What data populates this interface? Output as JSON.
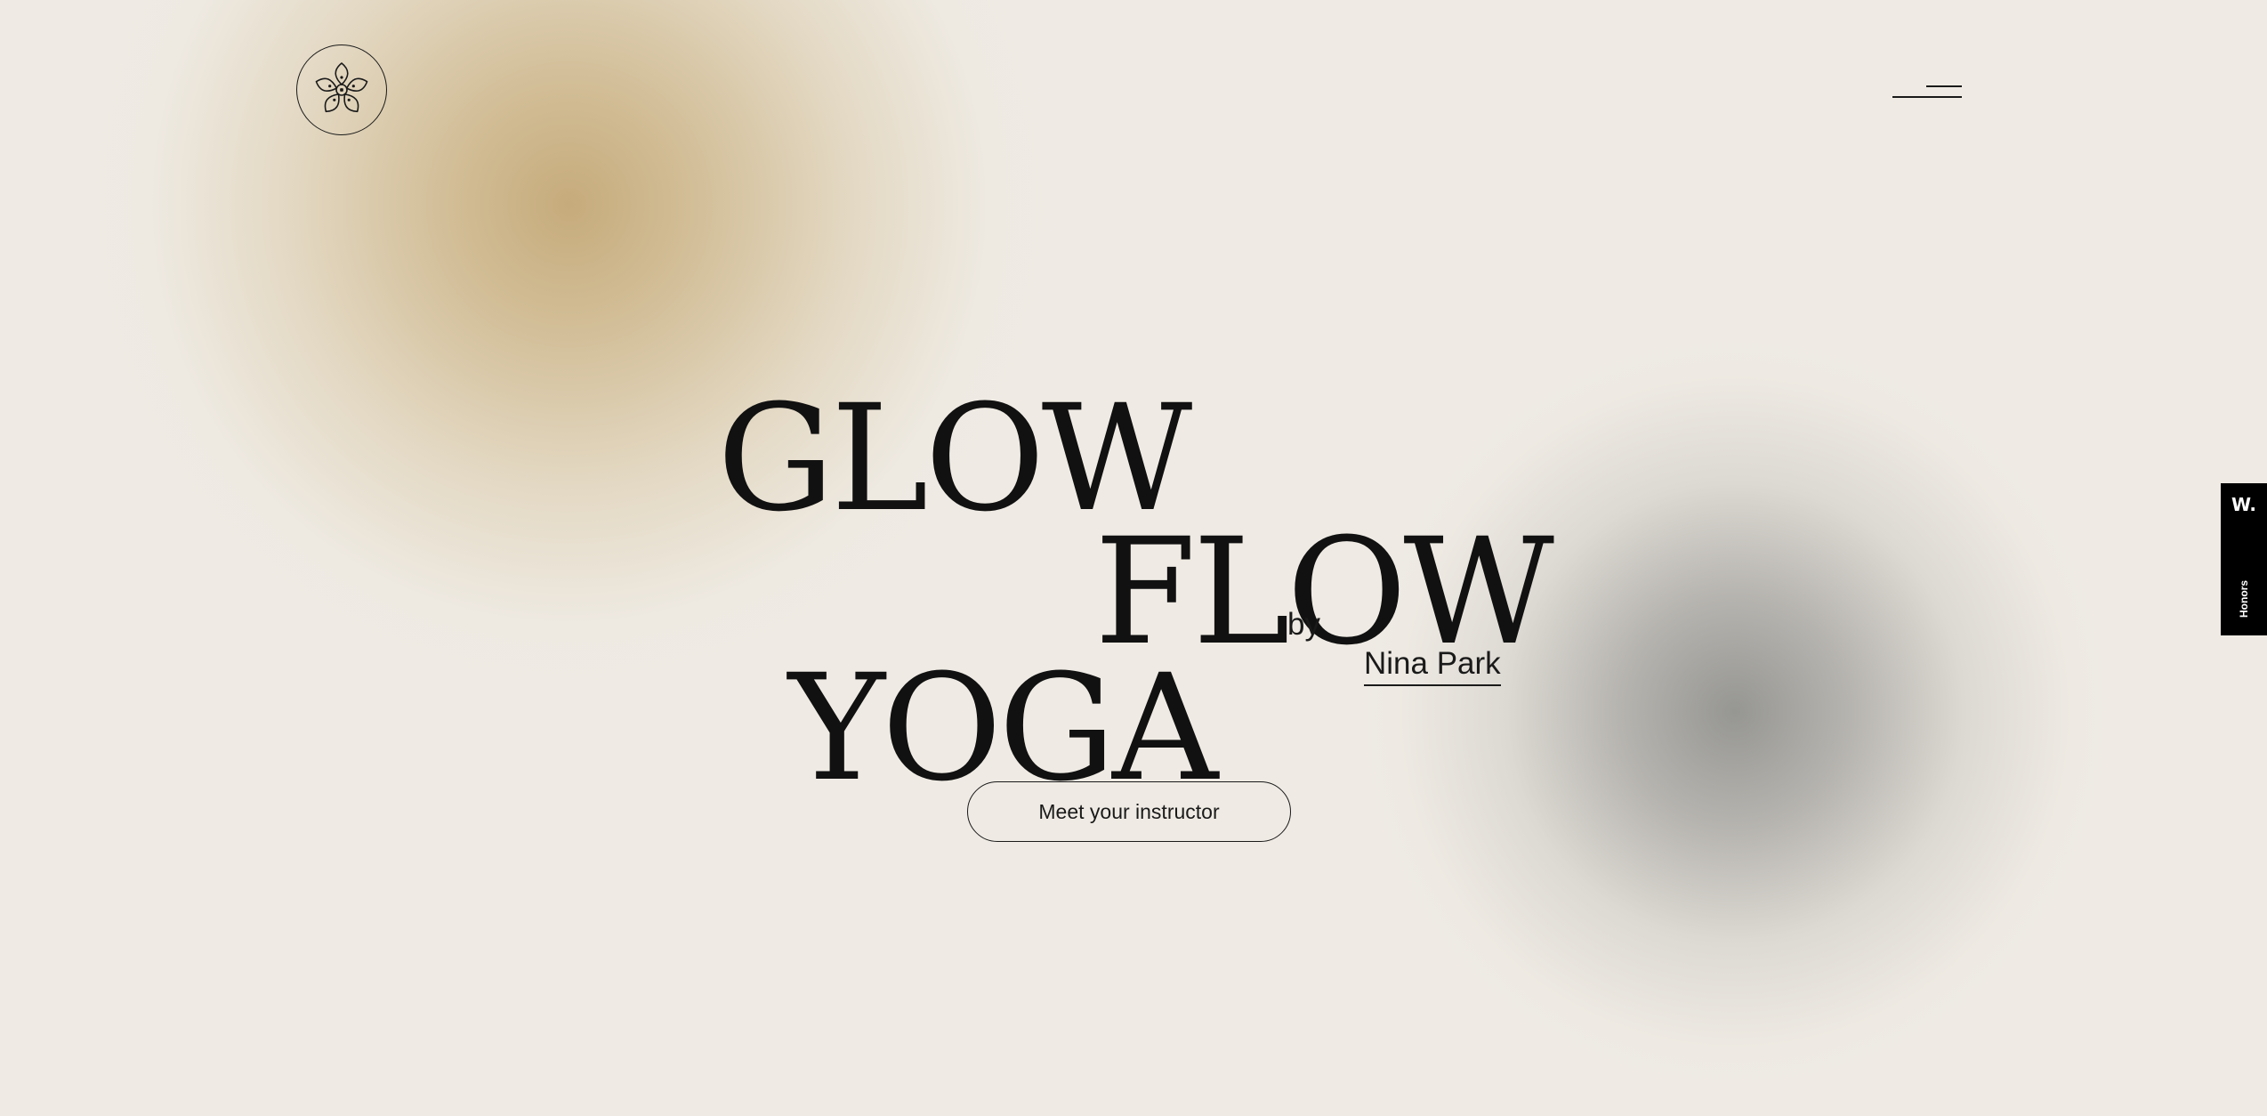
{
  "header": {
    "logo_icon": "flower-icon",
    "menu_icon": "hamburger-menu-icon"
  },
  "hero": {
    "title_line1": "GLOW",
    "title_line2": "FLOW",
    "title_line3": "YOGA",
    "by_label": "by",
    "author": "Nina Park",
    "cta_label": "Meet your instructor"
  },
  "award_badge": {
    "mark": "W.",
    "label": "Honors"
  },
  "colors": {
    "background": "#efebe4",
    "gold_glow": "#c4a876",
    "grey_glow": "#969692",
    "text": "#111111",
    "badge": "#000000"
  }
}
